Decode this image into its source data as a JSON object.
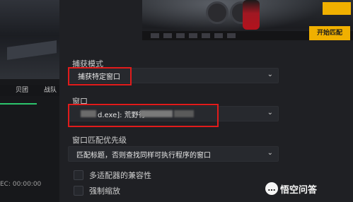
{
  "left": {
    "tabs": [
      "贝团",
      "战队"
    ],
    "timecode": "EC: 00:00:00"
  },
  "preview": {
    "start_button": "开始匹配"
  },
  "capture_mode": {
    "label": "捕获模式",
    "value": "捕获特定窗口"
  },
  "window": {
    "label": "窗口",
    "value_prefix": "d.exe]: 荒野行"
  },
  "match_priority": {
    "label": "窗口匹配优先级",
    "value": "匹配标题，否则查找同样可执行程序的窗口"
  },
  "options": [
    {
      "label": "多适配器的兼容性",
      "checked": false
    },
    {
      "label": "强制缩放",
      "checked": false
    }
  ],
  "brand": {
    "icon_glyph": "…",
    "name": "悟空问答"
  },
  "colors": {
    "highlight": "#e11b1b",
    "accent_yellow": "#f0b000",
    "accent_green": "#2cc46c"
  }
}
